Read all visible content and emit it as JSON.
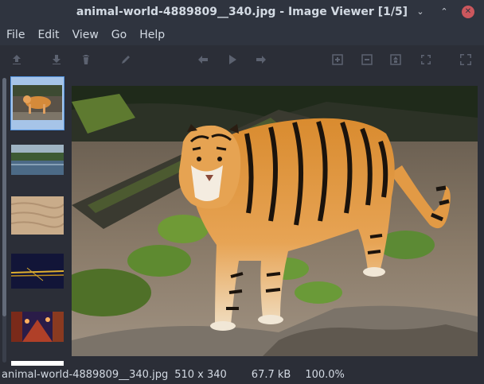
{
  "window": {
    "title": "animal-world-4889809__340.jpg - Image Viewer [1/5]",
    "controls": [
      "minimize-icon",
      "maximize-icon",
      "close-icon"
    ],
    "close_color": "#cc575d"
  },
  "menu": {
    "items": [
      {
        "label": "File"
      },
      {
        "label": "Edit"
      },
      {
        "label": "View"
      },
      {
        "label": "Go"
      },
      {
        "label": "Help"
      }
    ]
  },
  "toolbar": {
    "icons": [
      "upload-icon",
      "download-icon",
      "trash-icon",
      "edit-icon",
      "arrow-left-icon",
      "play-icon",
      "arrow-right-icon",
      "zoom-in-icon",
      "zoom-out-icon",
      "zoom-fit-icon",
      "zoom-original-icon",
      "fullscreen-icon"
    ]
  },
  "thumbnails": [
    {
      "name": "tiger",
      "selected": true
    },
    {
      "name": "lake",
      "selected": false
    },
    {
      "name": "sand",
      "selected": false
    },
    {
      "name": "night-lights",
      "selected": false
    },
    {
      "name": "street-lights",
      "selected": false
    }
  ],
  "image": {
    "description_icon": "tiger-photo"
  },
  "status": {
    "filename": "animal-world-4889809__340.jpg",
    "dimensions": "510 x 340",
    "size": "67.7 kB",
    "zoom": "100.0%"
  },
  "colors": {
    "accent": "#5294e2",
    "titlebar": "#2f343f",
    "background": "#2b2e37"
  }
}
